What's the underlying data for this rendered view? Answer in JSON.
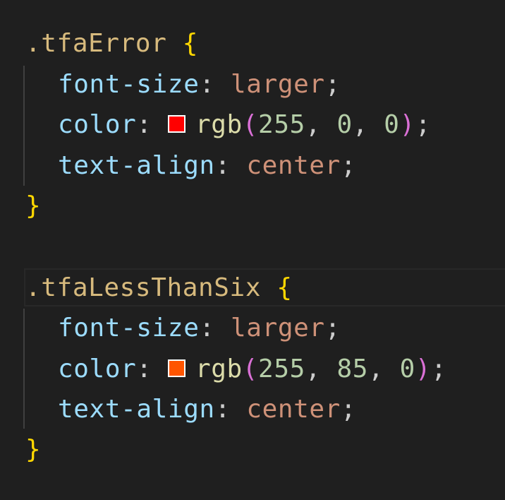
{
  "code": {
    "blocks": [
      {
        "selector": ".tfaError",
        "open_brace": "{",
        "close_brace": "}",
        "declarations": [
          {
            "property": "font-size",
            "colon": ":",
            "value": "larger",
            "semicolon": ";"
          },
          {
            "property": "color",
            "colon": ":",
            "fn": "rgb",
            "open_paren": "(",
            "args": [
              "255",
              "0",
              "0"
            ],
            "close_paren": ")",
            "semicolon": ";",
            "swatch_color": "#ff0000"
          },
          {
            "property": "text-align",
            "colon": ":",
            "value": "center",
            "semicolon": ";"
          }
        ]
      },
      {
        "selector": ".tfaLessThanSix",
        "open_brace": "{",
        "close_brace": "}",
        "declarations": [
          {
            "property": "font-size",
            "colon": ":",
            "value": "larger",
            "semicolon": ";"
          },
          {
            "property": "color",
            "colon": ":",
            "fn": "rgb",
            "open_paren": "(",
            "args": [
              "255",
              "85",
              "0"
            ],
            "close_paren": ")",
            "semicolon": ";",
            "swatch_color": "#ff5500"
          },
          {
            "property": "text-align",
            "colon": ":",
            "value": "center",
            "semicolon": ";"
          }
        ]
      }
    ],
    "comma": ", "
  },
  "colors": {
    "background": "#1f1f1f",
    "selector": "#d7ba7d",
    "brace": "#ffd700",
    "property": "#9cdcfe",
    "value": "#ce9178",
    "function": "#dcdcaa",
    "paren": "#da70d6",
    "number": "#b5cea8"
  }
}
